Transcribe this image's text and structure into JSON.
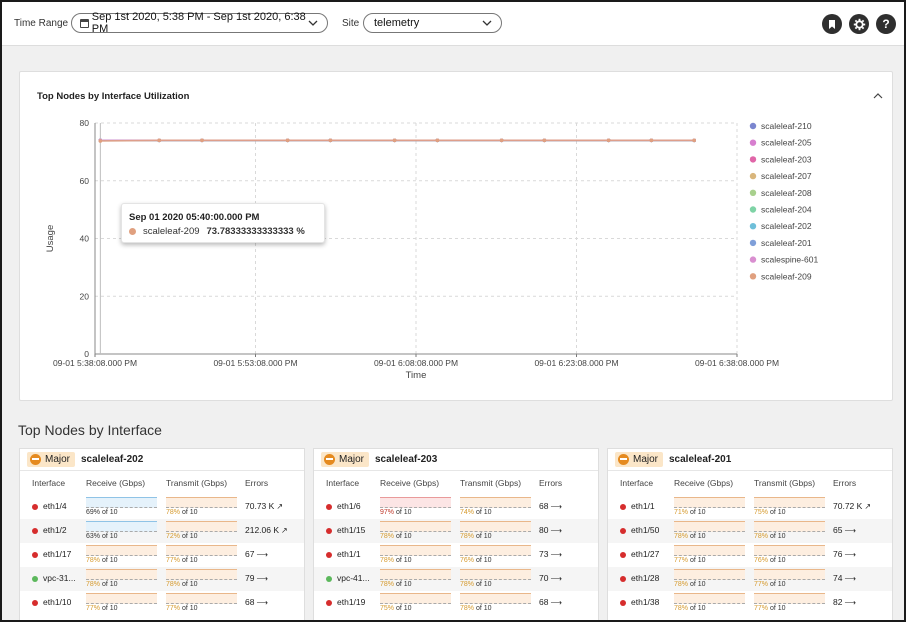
{
  "toolbar": {
    "time_range_label": "Time Range",
    "time_range_value": "Sep 1st 2020, 5:38 PM - Sep 1st 2020, 6:38 PM",
    "site_label": "Site",
    "site_value": "telemetry",
    "icons": [
      "bookmark-icon",
      "gear-icon",
      "help-icon"
    ],
    "help_glyph": "?"
  },
  "chart_card": {
    "title": "Top Nodes by Interface Utilization",
    "tooltip": {
      "time": "Sep 01 2020 05:40:00.000 PM",
      "series": "scaleleaf-209",
      "value": "73.78333333333333 %"
    }
  },
  "chart_data": {
    "type": "line",
    "xlabel": "Time",
    "ylabel": "Usage",
    "ylim": [
      0,
      80
    ],
    "yticks": [
      0,
      20,
      40,
      60,
      80
    ],
    "xticks": [
      "09-01 5:38:08.000 PM",
      "09-01 5:53:08.000 PM",
      "09-01 6:08:08.000 PM",
      "09-01 6:23:08.000 PM",
      "09-01 6:38:08.000 PM"
    ],
    "grid": true,
    "legend_position": "right",
    "x_minutes_points": [
      0.5,
      6,
      10,
      18,
      22,
      28,
      32,
      38,
      42,
      48,
      52,
      56
    ],
    "series": [
      {
        "name": "scaleleaf-210",
        "color": "#7b86cf",
        "values": [
          74,
          74,
          74,
          74,
          74,
          74,
          74,
          74,
          74,
          74,
          74,
          74
        ]
      },
      {
        "name": "scaleleaf-205",
        "color": "#d77fcf",
        "values": [
          74,
          74,
          74,
          74,
          74,
          74,
          74,
          74,
          74,
          74,
          74,
          74
        ]
      },
      {
        "name": "scaleleaf-203",
        "color": "#e066a8",
        "values": [
          74,
          74,
          74,
          74,
          74,
          74,
          74,
          74,
          74,
          74,
          74,
          74
        ]
      },
      {
        "name": "scaleleaf-207",
        "color": "#d9b67c",
        "values": [
          74,
          74,
          74,
          74,
          74,
          74,
          74,
          74,
          74,
          74,
          74,
          74
        ]
      },
      {
        "name": "scaleleaf-208",
        "color": "#a8d08d",
        "values": [
          74,
          74,
          74,
          74,
          74,
          74,
          74,
          74,
          74,
          74,
          74,
          74
        ]
      },
      {
        "name": "scaleleaf-204",
        "color": "#7fd3a6",
        "values": [
          74,
          74,
          74,
          74,
          74,
          74,
          74,
          74,
          74,
          74,
          74,
          74
        ]
      },
      {
        "name": "scaleleaf-202",
        "color": "#6fbfd9",
        "values": [
          74,
          74,
          74,
          74,
          74,
          74,
          74,
          74,
          74,
          74,
          74,
          74
        ]
      },
      {
        "name": "scaleleaf-201",
        "color": "#7f9fd9",
        "values": [
          74,
          74,
          74,
          74,
          74,
          74,
          74,
          74,
          74,
          74,
          74,
          74
        ]
      },
      {
        "name": "scalespine-601",
        "color": "#d98fd0",
        "values": [
          74,
          74,
          74,
          74,
          74,
          74,
          74,
          74,
          74,
          74,
          74,
          74
        ]
      },
      {
        "name": "scaleleaf-209",
        "color": "#e0a07f",
        "values": [
          73.78,
          74,
          74,
          74,
          74,
          74,
          74,
          74,
          74,
          74,
          74,
          74
        ]
      }
    ]
  },
  "section": {
    "title": "Top Nodes by Interface"
  },
  "table_headers": {
    "interface": "Interface",
    "receive": "Receive (Gbps)",
    "transmit": "Transmit (Gbps)",
    "errors": "Errors"
  },
  "panels": [
    {
      "severity": "Major",
      "node": "scaleleaf-202",
      "rows": [
        {
          "status": "red",
          "iface": "eth1/4",
          "rx_pct": "69%",
          "rx_of": " of 10",
          "rx_style": "blue",
          "tx_pct": "78%",
          "tx_of": " of 10",
          "errors": "70.73 K",
          "trend": "up"
        },
        {
          "status": "red",
          "iface": "eth1/2",
          "rx_pct": "63%",
          "rx_of": " of 10",
          "rx_style": "blue",
          "tx_pct": "72%",
          "tx_of": " of 10",
          "errors": "212.06 K",
          "trend": "up"
        },
        {
          "status": "red",
          "iface": "eth1/17",
          "rx_pct": "78%",
          "rx_of": " of 10",
          "rx_style": "orange",
          "tx_pct": "77%",
          "tx_of": " of 10",
          "errors": "67",
          "trend": "flat"
        },
        {
          "status": "green",
          "iface": "vpc-31...",
          "rx_pct": "78%",
          "rx_of": " of 10",
          "rx_style": "orange",
          "tx_pct": "78%",
          "tx_of": " of 10",
          "errors": "79",
          "trend": "flat"
        },
        {
          "status": "red",
          "iface": "eth1/10",
          "rx_pct": "77%",
          "rx_of": " of 10",
          "rx_style": "orange",
          "tx_pct": "77%",
          "tx_of": " of 10",
          "errors": "68",
          "trend": "flat"
        }
      ]
    },
    {
      "severity": "Major",
      "node": "scaleleaf-203",
      "rows": [
        {
          "status": "red",
          "iface": "eth1/6",
          "rx_pct": "97%",
          "rx_of": " of 10",
          "rx_style": "red",
          "tx_pct": "74%",
          "tx_of": " of 10",
          "errors": "68",
          "trend": "flat"
        },
        {
          "status": "red",
          "iface": "eth1/15",
          "rx_pct": "78%",
          "rx_of": " of 10",
          "rx_style": "orange",
          "tx_pct": "78%",
          "tx_of": " of 10",
          "errors": "80",
          "trend": "flat"
        },
        {
          "status": "red",
          "iface": "eth1/1",
          "rx_pct": "78%",
          "rx_of": " of 10",
          "rx_style": "orange",
          "tx_pct": "76%",
          "tx_of": " of 10",
          "errors": "73",
          "trend": "flat"
        },
        {
          "status": "green",
          "iface": "vpc-41...",
          "rx_pct": "78%",
          "rx_of": " of 10",
          "rx_style": "orange",
          "tx_pct": "78%",
          "tx_of": " of 10",
          "errors": "70",
          "trend": "flat"
        },
        {
          "status": "red",
          "iface": "eth1/19",
          "rx_pct": "75%",
          "rx_of": " of 10",
          "rx_style": "orange",
          "tx_pct": "78%",
          "tx_of": " of 10",
          "errors": "68",
          "trend": "flat"
        }
      ]
    },
    {
      "severity": "Major",
      "node": "scaleleaf-201",
      "rows": [
        {
          "status": "red",
          "iface": "eth1/1",
          "rx_pct": "71%",
          "rx_of": " of 10",
          "rx_style": "orange",
          "tx_pct": "75%",
          "tx_of": " of 10",
          "errors": "70.72 K",
          "trend": "up"
        },
        {
          "status": "red",
          "iface": "eth1/50",
          "rx_pct": "78%",
          "rx_of": " of 10",
          "rx_style": "orange",
          "tx_pct": "78%",
          "tx_of": " of 10",
          "errors": "65",
          "trend": "flat"
        },
        {
          "status": "red",
          "iface": "eth1/27",
          "rx_pct": "77%",
          "rx_of": " of 10",
          "rx_style": "orange",
          "tx_pct": "76%",
          "tx_of": " of 10",
          "errors": "76",
          "trend": "flat"
        },
        {
          "status": "red",
          "iface": "eth1/28",
          "rx_pct": "78%",
          "rx_of": " of 10",
          "rx_style": "orange",
          "tx_pct": "77%",
          "tx_of": " of 10",
          "errors": "74",
          "trend": "flat"
        },
        {
          "status": "red",
          "iface": "eth1/38",
          "rx_pct": "78%",
          "rx_of": " of 10",
          "rx_style": "orange",
          "tx_pct": "77%",
          "tx_of": " of 10",
          "errors": "82",
          "trend": "flat"
        }
      ]
    }
  ],
  "colors": {
    "status_red": "#d62d2d",
    "status_green": "#5cb85c",
    "severity_bg": "#fbe6c8",
    "severity_icon": "#e58a1f"
  }
}
